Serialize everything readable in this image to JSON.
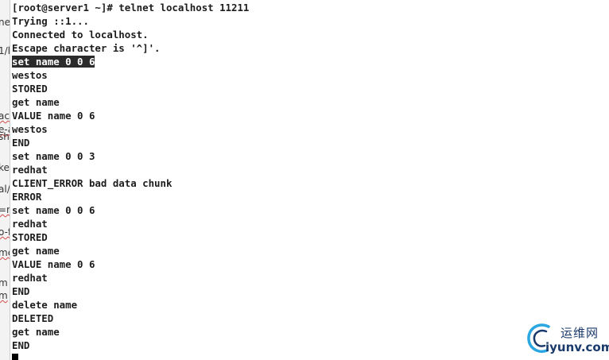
{
  "background_document": {
    "fragments": [
      {
        "text": "ne",
        "squiggle": false
      },
      {
        "text": "1/l",
        "squiggle": false
      },
      {
        "text": "ac",
        "squiggle": true
      },
      {
        "text": "e-a",
        "squiggle": true
      },
      {
        "text": "sh_",
        "squiggle": false
      },
      {
        "text": "ke",
        "squiggle": false
      },
      {
        "text": "al/",
        "squiggle": false
      },
      {
        "text": "=n",
        "squiggle": true
      },
      {
        "text": "o-f",
        "squiggle": true
      },
      {
        "text": "me",
        "squiggle": true
      },
      {
        "text": "m",
        "squiggle": false
      },
      {
        "text": "m",
        "squiggle": true
      }
    ]
  },
  "terminal": {
    "lines": [
      {
        "text": "[root@server1 ~]# telnet localhost 11211",
        "selected": false
      },
      {
        "text": "Trying ::1...",
        "selected": false
      },
      {
        "text": "Connected to localhost.",
        "selected": false
      },
      {
        "text": "Escape character is '^]'.",
        "selected": false
      },
      {
        "text": "set name 0 0 6",
        "selected": true
      },
      {
        "text": "westos",
        "selected": false
      },
      {
        "text": "STORED",
        "selected": false
      },
      {
        "text": "get name",
        "selected": false
      },
      {
        "text": "VALUE name 0 6",
        "selected": false
      },
      {
        "text": "westos",
        "selected": false
      },
      {
        "text": "END",
        "selected": false
      },
      {
        "text": "set name 0 0 3",
        "selected": false
      },
      {
        "text": "redhat",
        "selected": false
      },
      {
        "text": "CLIENT_ERROR bad data chunk",
        "selected": false
      },
      {
        "text": "ERROR",
        "selected": false
      },
      {
        "text": "set name 0 0 6",
        "selected": false
      },
      {
        "text": "redhat",
        "selected": false
      },
      {
        "text": "STORED",
        "selected": false
      },
      {
        "text": "get name",
        "selected": false
      },
      {
        "text": "VALUE name 0 6",
        "selected": false
      },
      {
        "text": "redhat",
        "selected": false
      },
      {
        "text": "END",
        "selected": false
      },
      {
        "text": "delete name",
        "selected": false
      },
      {
        "text": "DELETED",
        "selected": false
      },
      {
        "text": "get name",
        "selected": false
      },
      {
        "text": "END",
        "selected": false
      },
      {
        "text": "",
        "selected": false
      }
    ],
    "cursor_icon": "block-cursor-icon",
    "selection_color": "#2b2b2b",
    "text_color": "#1c1c1c"
  },
  "watermark": {
    "icon": "swirl-logo-icon",
    "text_cn": "运维网",
    "text_en": "iyunv.com",
    "color": "#1a3a6b",
    "accent": "#2aa6e0"
  }
}
